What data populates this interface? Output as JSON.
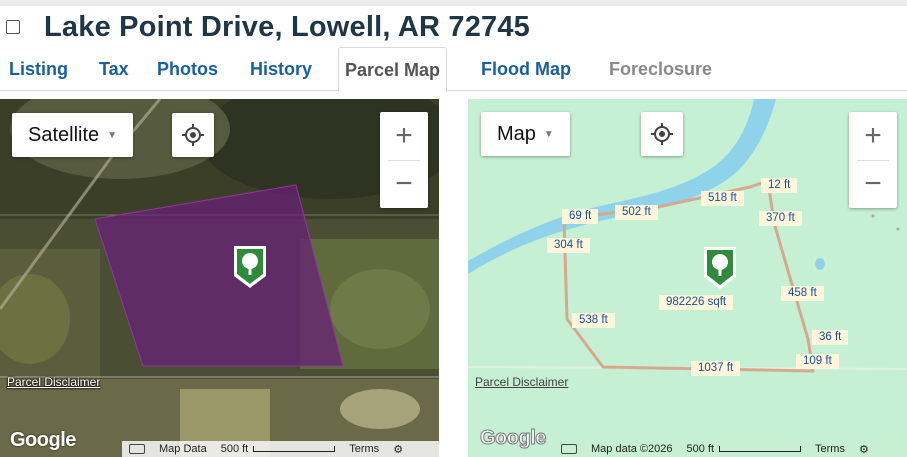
{
  "page": {
    "title": "Lake Point Drive, Lowell, AR 72745"
  },
  "tabs": [
    {
      "label": "Listing",
      "state": "link"
    },
    {
      "label": "Tax",
      "state": "link"
    },
    {
      "label": "Photos",
      "state": "link"
    },
    {
      "label": "History",
      "state": "link"
    },
    {
      "label": "Parcel Map",
      "state": "active"
    },
    {
      "label": "Flood Map",
      "state": "link"
    },
    {
      "label": "Foreclosure",
      "state": "disabled"
    }
  ],
  "left_map": {
    "map_type": "Satellite",
    "zoom_in": "+",
    "zoom_out": "−",
    "disclaimer": "Parcel Disclaimer",
    "logo": "Google",
    "attribution": {
      "map_data": "Map Data",
      "scale": "500 ft",
      "terms": "Terms"
    },
    "icons": [
      "locate-icon",
      "keyboard-icon",
      "gear-icon",
      "parcel-tree-marker-icon"
    ],
    "parcel_color": "#6a1f7a"
  },
  "right_map": {
    "map_type": "Map",
    "zoom_in": "+",
    "zoom_out": "−",
    "disclaimer": "Parcel Disclaimer",
    "logo": "Google",
    "attribution": {
      "map_data": "Map data ©2026",
      "scale": "500 ft",
      "terms": "Terms"
    },
    "labels": {
      "d12": "12 ft",
      "d518": "518 ft",
      "d502": "502 ft",
      "d69": "69 ft",
      "d370": "370 ft",
      "d304": "304 ft",
      "area": "982226 sqft",
      "d458": "458 ft",
      "d538": "538 ft",
      "d36": "36 ft",
      "d109": "109 ft",
      "d1037": "1037 ft"
    },
    "colors": {
      "land": "#c6f0d3",
      "water": "#8fd3ea",
      "boundary": "#d8a88e"
    }
  },
  "brand": {
    "link": "#1a5f9e",
    "title": "#1f3646",
    "marker": "#2e8b3a"
  }
}
